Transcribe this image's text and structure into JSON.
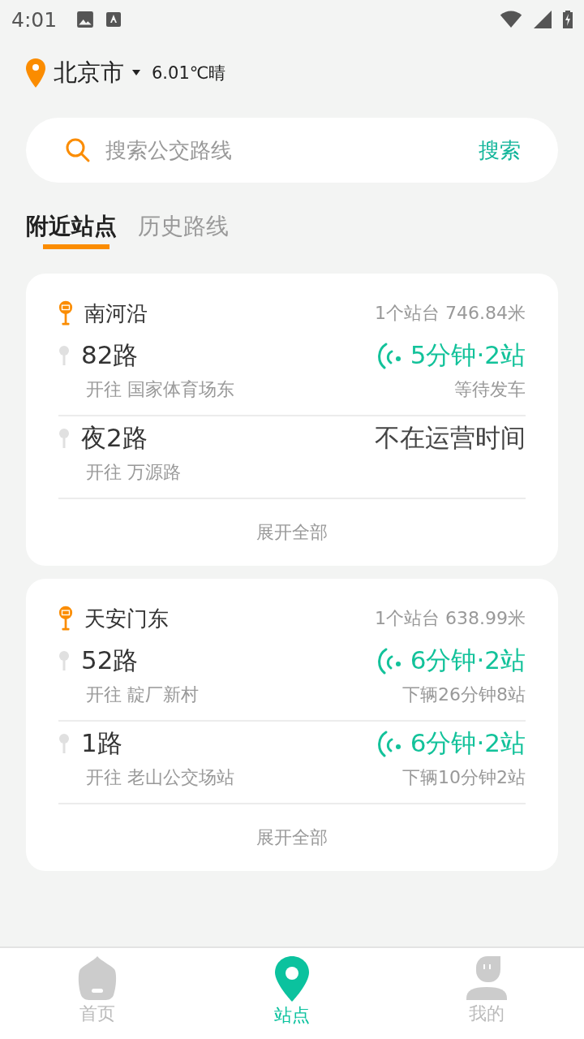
{
  "status_bar": {
    "time": "4:01"
  },
  "location": {
    "city": "北京市",
    "weather": "6.01℃晴"
  },
  "search": {
    "placeholder": "搜索公交路线",
    "button": "搜索"
  },
  "tabs": [
    {
      "label": "附近站点",
      "selected": true
    },
    {
      "label": "历史路线",
      "selected": false
    }
  ],
  "stations": [
    {
      "name": "南河沿",
      "info": "1个站台 746.84米",
      "expand": "展开全部",
      "routes": [
        {
          "line": "82路",
          "direction": "开往 国家体育场东",
          "kind": "realtime",
          "arrival": "5分钟·2站",
          "next": "等待发车"
        },
        {
          "line": "夜2路",
          "direction": "开往 万源路",
          "kind": "closed",
          "arrival": "不在运营时间"
        }
      ]
    },
    {
      "name": "天安门东",
      "info": "1个站台 638.99米",
      "expand": "展开全部",
      "routes": [
        {
          "line": "52路",
          "direction": "开往 靛厂新村",
          "kind": "realtime",
          "arrival": "6分钟·2站",
          "next": "下辆26分钟8站"
        },
        {
          "line": "1路",
          "direction": "开往 老山公交场站",
          "kind": "realtime",
          "arrival": "6分钟·2站",
          "next": "下辆10分钟2站"
        }
      ]
    }
  ],
  "nav": [
    {
      "label": "首页",
      "kind": "home",
      "selected": false
    },
    {
      "label": "站点",
      "kind": "stops",
      "selected": true
    },
    {
      "label": "我的",
      "kind": "me",
      "selected": false
    }
  ]
}
